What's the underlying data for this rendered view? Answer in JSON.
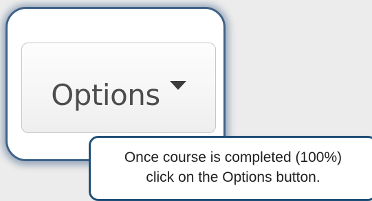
{
  "options_button": {
    "label": "Options",
    "icon": "caret-down-icon"
  },
  "instruction": {
    "line1": "Once course is completed (100%)",
    "line2": "click on the Options button."
  },
  "colors": {
    "page_background": "#ececec",
    "card_border": "#3e6187",
    "tooltip_border": "#1f4f78",
    "button_text": "#4d4d4d"
  }
}
